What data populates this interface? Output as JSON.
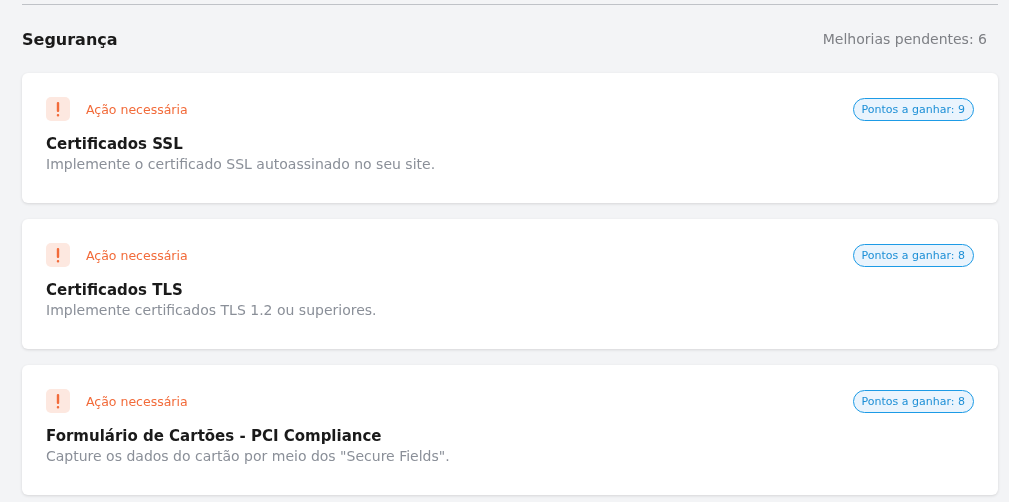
{
  "section": {
    "title": "Segurança",
    "pending": "Melhorias pendentes: 6"
  },
  "items": [
    {
      "status": {
        "kind": "action_required",
        "label": "Ação necessária"
      },
      "points": "Pontos a ganhar: 9",
      "title": "Certificados SSL",
      "description": "Implemente o certificado SSL autoassinado no seu site."
    },
    {
      "status": {
        "kind": "action_required",
        "label": "Ação necessária"
      },
      "points": "Pontos a ganhar: 8",
      "title": "Certificados TLS",
      "description": "Implemente certificados TLS 1.2 ou superiores."
    },
    {
      "status": {
        "kind": "action_required",
        "label": "Ação necessária"
      },
      "points": "Pontos a ganhar: 8",
      "title": "Formulário de Cartões - PCI Compliance",
      "description": "Capture os dados do cartão por meio dos \"Secure Fields\"."
    }
  ]
}
